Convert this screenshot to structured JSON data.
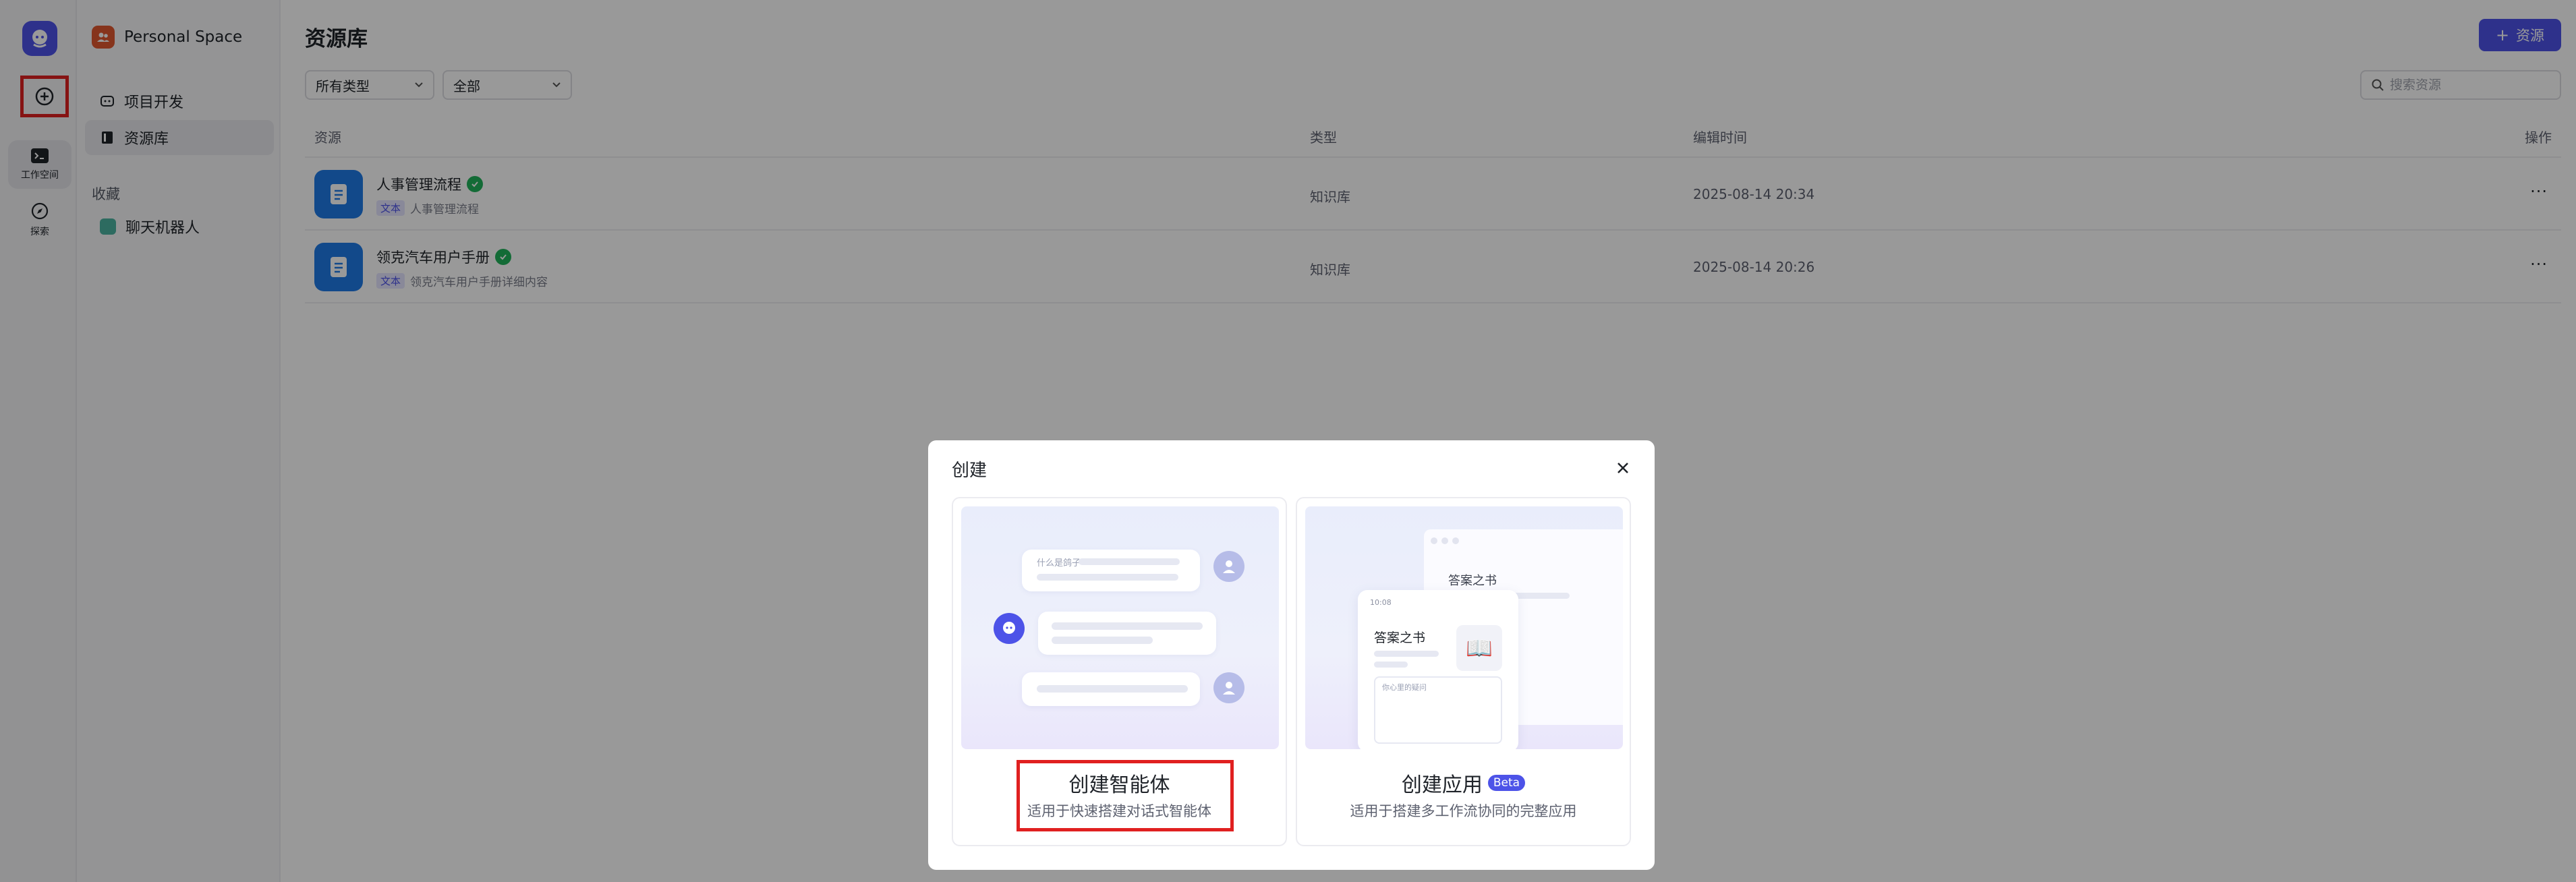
{
  "rail": {
    "workspace_label": "工作空间",
    "explore_label": "探索"
  },
  "sidebar": {
    "space_name": "Personal Space",
    "nav": [
      {
        "label": "项目开发"
      },
      {
        "label": "资源库"
      }
    ],
    "favorites_title": "收藏",
    "favorites": [
      {
        "label": "聊天机器人"
      }
    ]
  },
  "main": {
    "title": "资源库",
    "add_button": "资源",
    "filter_type": "所有类型",
    "filter_all": "全部",
    "search_placeholder": "搜索资源",
    "columns": [
      "资源",
      "类型",
      "编辑时间",
      "操作"
    ],
    "rows": [
      {
        "name": "人事管理流程",
        "tag": "文本",
        "desc": "人事管理流程",
        "type": "知识库",
        "time": "2025-08-14 20:34"
      },
      {
        "name": "领克汽车用户手册",
        "tag": "文本",
        "desc": "领克汽车用户手册详细内容",
        "type": "知识库",
        "time": "2025-08-14 20:26"
      }
    ]
  },
  "modal": {
    "title": "创建",
    "cards": [
      {
        "title": "创建智能体",
        "desc": "适用于快速搭建对话式智能体",
        "art_bubble_text": "什么是鸽子"
      },
      {
        "title": "创建应用",
        "badge": "Beta",
        "desc": "适用于搭建多工作流协同的完整应用",
        "art_window_title": "答案之书",
        "art_phone_title": "答案之书",
        "art_phone_time": "10:08",
        "art_phone_input": "你心里的疑问"
      }
    ]
  },
  "colors": {
    "brand": "#4d53e8",
    "highlight": "#e02020",
    "doc_icon": "#1e7ae6",
    "verified": "#21b35a"
  }
}
